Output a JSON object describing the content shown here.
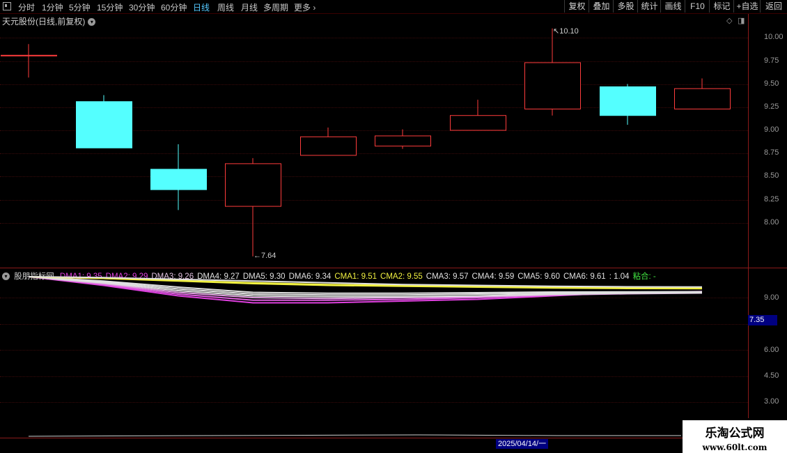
{
  "toolbar": {
    "periods": [
      "分时",
      "1分钟",
      "5分钟",
      "15分钟",
      "30分钟",
      "60分钟",
      "日线",
      "周线",
      "月线",
      "多周期",
      "更多"
    ],
    "active_period": "日线",
    "buttons": [
      "复权",
      "叠加",
      "多股",
      "统计",
      "画线",
      "F10",
      "标记",
      "+自选",
      "返回"
    ]
  },
  "price_pane": {
    "title": "天元股份(日线,前复权)",
    "ticks": [
      "10.00",
      "9.75",
      "9.50",
      "9.25",
      "9.00",
      "8.75",
      "8.50",
      "8.25",
      "8.00"
    ],
    "high_annotation": "10.10",
    "low_annotation": "7.64"
  },
  "indicator_pane": {
    "name": "股朋指标网",
    "legend": [
      {
        "label": "DMA1: 9.35",
        "color": "#e040e0"
      },
      {
        "label": "DMA2: 9.29",
        "color": "#e040e0"
      },
      {
        "label": "DMA3: 9.26",
        "color": "#e0c0e0"
      },
      {
        "label": "DMA4: 9.27",
        "color": "#e0e0e0"
      },
      {
        "label": "DMA5: 9.30",
        "color": "#e0e0e0"
      },
      {
        "label": "DMA6: 9.34",
        "color": "#e0e0e0"
      },
      {
        "label": "CMA1: 9.51",
        "color": "#f0f040"
      },
      {
        "label": "CMA2: 9.55",
        "color": "#f0f040"
      },
      {
        "label": "CMA3: 9.57",
        "color": "#e0e0e0"
      },
      {
        "label": "CMA4: 9.59",
        "color": "#e0e0e0"
      },
      {
        "label": "CMA5: 9.60",
        "color": "#e0e0e0"
      },
      {
        "label": "CMA6: 9.61",
        "color": "#e0e0e0"
      },
      {
        "label": ": 1.04",
        "color": "#e0e0e0"
      },
      {
        "label": "粘合: -",
        "color": "#40e040"
      }
    ],
    "ticks": [
      "9.00",
      "6.00",
      "4.50",
      "3.00"
    ],
    "current_value": "7.35"
  },
  "bottom_bar": {
    "date_label": "2025/04/14/一"
  },
  "watermark": {
    "line1": "乐淘公式网",
    "line2": "www.60lt.com"
  },
  "colors": {
    "up_candle": "#ff3c3c",
    "down_candle": "#54ffff",
    "border": "#8b1a1a"
  },
  "chart_data": {
    "type": "candlestick",
    "price_range": [
      7.55,
      10.15
    ],
    "candles": [
      {
        "open": 9.81,
        "high": 9.93,
        "low": 9.57,
        "close": 9.81,
        "direction": "flat"
      },
      {
        "open": 9.31,
        "high": 9.38,
        "low": 8.81,
        "close": 8.81,
        "direction": "down"
      },
      {
        "open": 8.58,
        "high": 8.85,
        "low": 8.14,
        "close": 8.36,
        "direction": "down"
      },
      {
        "open": 8.18,
        "high": 8.7,
        "low": 7.64,
        "close": 8.64,
        "direction": "up"
      },
      {
        "open": 8.73,
        "high": 9.03,
        "low": 8.73,
        "close": 8.93,
        "direction": "up"
      },
      {
        "open": 8.83,
        "high": 9.01,
        "low": 8.8,
        "close": 8.94,
        "direction": "up"
      },
      {
        "open": 9.0,
        "high": 9.33,
        "low": 9.0,
        "close": 9.16,
        "direction": "up"
      },
      {
        "open": 9.23,
        "high": 10.1,
        "low": 9.16,
        "close": 9.73,
        "direction": "up"
      },
      {
        "open": 9.47,
        "high": 9.5,
        "low": 9.06,
        "close": 9.16,
        "direction": "down"
      },
      {
        "open": 9.23,
        "high": 9.56,
        "low": 9.23,
        "close": 9.45,
        "direction": "up"
      }
    ],
    "indicator_range": [
      2.5,
      10.6
    ],
    "indicator_series": [
      {
        "name": "DMA1",
        "color": "#e040e0",
        "values": [
          10.2,
          9.7,
          9.1,
          8.7,
          8.7,
          8.8,
          8.9,
          9.1,
          9.3,
          9.35
        ]
      },
      {
        "name": "DMA2",
        "color": "#e060e0",
        "values": [
          10.2,
          9.75,
          9.2,
          8.85,
          8.85,
          8.9,
          9.0,
          9.15,
          9.25,
          9.29
        ]
      },
      {
        "name": "DMA3",
        "color": "#e0a0e0",
        "values": [
          10.2,
          9.8,
          9.3,
          9.0,
          8.95,
          9.0,
          9.05,
          9.15,
          9.22,
          9.26
        ]
      },
      {
        "name": "DMA4",
        "color": "#e0e0e0",
        "values": [
          10.2,
          9.85,
          9.4,
          9.1,
          9.05,
          9.05,
          9.1,
          9.2,
          9.25,
          9.27
        ]
      },
      {
        "name": "DMA5",
        "color": "#e0e0e0",
        "values": [
          10.2,
          9.9,
          9.5,
          9.2,
          9.15,
          9.15,
          9.2,
          9.25,
          9.28,
          9.3
        ]
      },
      {
        "name": "DMA6",
        "color": "#e0e0e0",
        "values": [
          10.2,
          9.95,
          9.6,
          9.3,
          9.25,
          9.25,
          9.28,
          9.32,
          9.33,
          9.34
        ]
      },
      {
        "name": "CMA1",
        "color": "#f0f040",
        "values": [
          10.2,
          10.1,
          9.95,
          9.8,
          9.7,
          9.65,
          9.6,
          9.55,
          9.52,
          9.51
        ]
      },
      {
        "name": "CMA2",
        "color": "#f0f040",
        "values": [
          10.2,
          10.1,
          9.98,
          9.85,
          9.75,
          9.7,
          9.65,
          9.6,
          9.56,
          9.55
        ]
      },
      {
        "name": "CMA6",
        "color": "#e0e0e0",
        "values": [
          10.2,
          10.15,
          10.05,
          9.95,
          9.85,
          9.75,
          9.7,
          9.65,
          9.62,
          9.61
        ]
      }
    ]
  }
}
